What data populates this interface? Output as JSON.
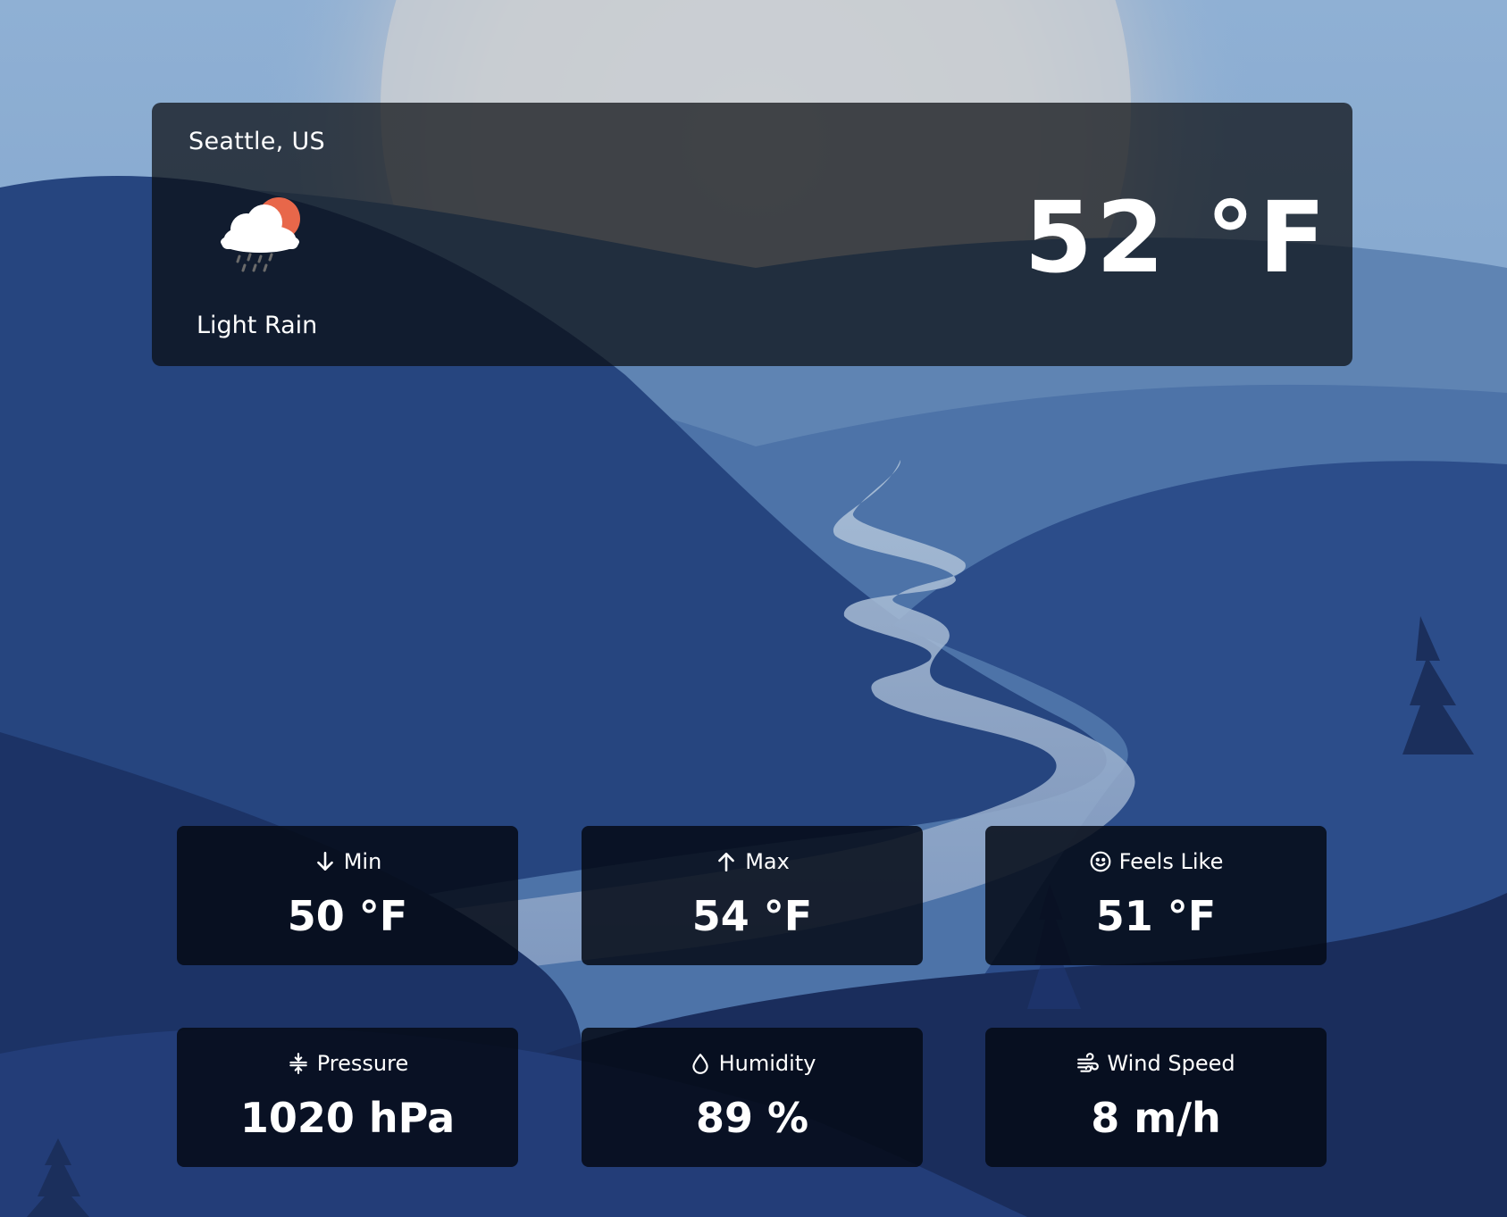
{
  "location": "Seattle, US",
  "current": {
    "condition": "Light Rain",
    "condition_icon": "cloud-rain-sun-icon",
    "temperature": "52 °F"
  },
  "stats": [
    {
      "key": "min",
      "label": "Min",
      "value": "50 °F",
      "icon": "arrow-down-icon"
    },
    {
      "key": "max",
      "label": "Max",
      "value": "54 °F",
      "icon": "arrow-up-icon"
    },
    {
      "key": "feels-like",
      "label": "Feels Like",
      "value": "51 °F",
      "icon": "smiley-icon"
    },
    {
      "key": "pressure",
      "label": "Pressure",
      "value": "1020 hPa",
      "icon": "pressure-icon"
    },
    {
      "key": "humidity",
      "label": "Humidity",
      "value": "89 %",
      "icon": "droplet-icon"
    },
    {
      "key": "wind-speed",
      "label": "Wind Speed",
      "value": "8 m/h",
      "icon": "wind-icon"
    }
  ],
  "colors": {
    "sun": "#e8674a",
    "sky": "#8fb0d4",
    "valley": "#2a4a85"
  }
}
